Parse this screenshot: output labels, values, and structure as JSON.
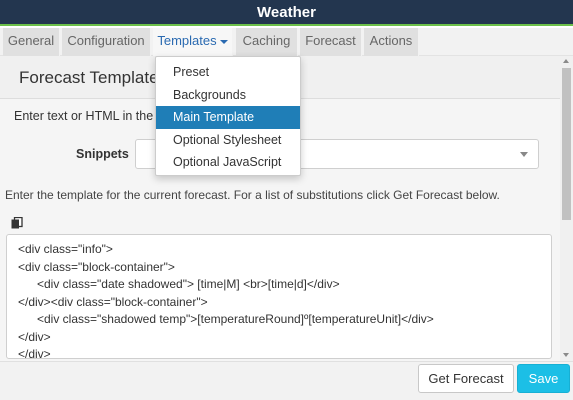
{
  "window": {
    "title": "Weather"
  },
  "tabs": [
    {
      "label": "General"
    },
    {
      "label": "Configuration"
    },
    {
      "label": "Templates",
      "active": true
    },
    {
      "label": "Caching"
    },
    {
      "label": "Forecast"
    },
    {
      "label": "Actions"
    }
  ],
  "panel": {
    "title": "Forecast Template",
    "instruction": "Enter text or HTML in the",
    "snippets_label": "Snippets",
    "snippets_value": "",
    "template_instruction": "Enter the template for the current forecast. For a list of substitutions click Get Forecast below.",
    "code_lines": [
      {
        "text": "<div class=\"info\">",
        "indent": false
      },
      {
        "text": "<div class=\"block-container\">",
        "indent": false
      },
      {
        "text": "<div class=\"date shadowed\"> [time|M] <br>[time|d]</div>",
        "indent": true
      },
      {
        "text": "</div><div class=\"block-container\">",
        "indent": false
      },
      {
        "text": "<div class=\"shadowed temp\">[temperatureRound]º[temperatureUnit]</div>",
        "indent": true
      },
      {
        "text": "</div>",
        "indent": false
      },
      {
        "text": "</div>",
        "indent": false
      }
    ]
  },
  "dropdown": {
    "items": [
      {
        "label": "Preset"
      },
      {
        "label": "Backgrounds"
      },
      {
        "label": "Main Template",
        "active": true
      },
      {
        "label": "Optional Stylesheet"
      },
      {
        "label": "Optional JavaScript"
      }
    ]
  },
  "footer": {
    "get_forecast_label": "Get Forecast",
    "save_label": "Save"
  },
  "colors": {
    "titlebar": "#23364f",
    "accent_green": "#6cc04a",
    "active_tab_text": "#2a6ab1",
    "dropdown_active": "#1f7eb7",
    "save_button": "#1cbfe6"
  },
  "icons": {
    "copy": "copy-icon",
    "tab_caret": "caret-down-icon",
    "select_caret": "chevron-down-icon"
  }
}
